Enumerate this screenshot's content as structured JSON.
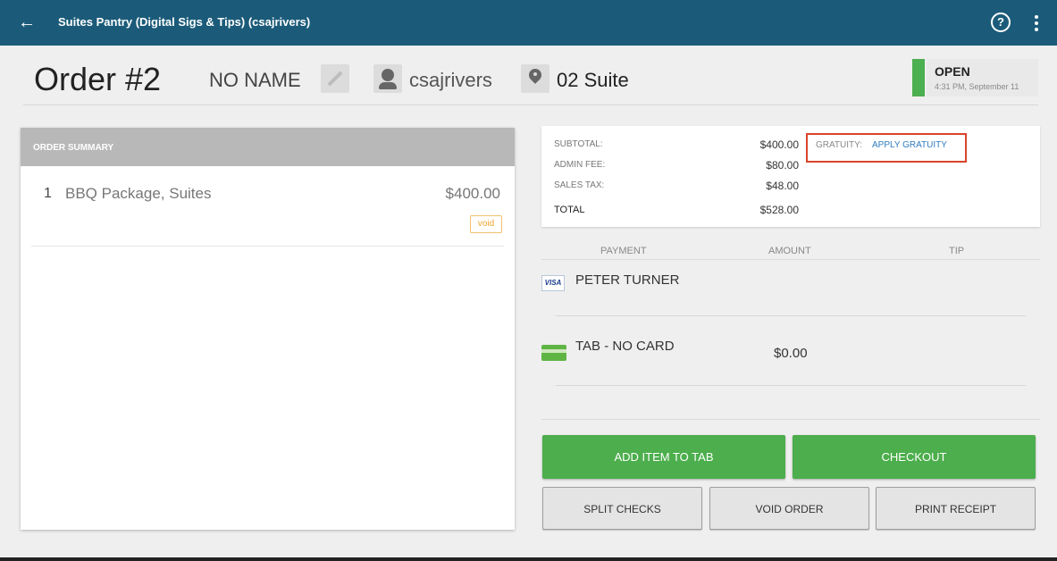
{
  "topbar": {
    "title": "Suites Pantry (Digital Sigs & Tips) (csajrivers)",
    "back_icon": "←",
    "help_icon": "?"
  },
  "header": {
    "order_title": "Order #2",
    "customer_name": "NO NAME",
    "user": "csajrivers",
    "location": "02 Suite",
    "status": "OPEN",
    "status_time": "4:31 PM, September 11"
  },
  "order_summary": {
    "heading": "ORDER SUMMARY",
    "items": [
      {
        "qty": "1",
        "name": "BBQ Package, Suites",
        "price": "$400.00",
        "void_label": "void"
      }
    ]
  },
  "totals": {
    "subtotal_label": "SUBTOTAL:",
    "subtotal": "$400.00",
    "admin_fee_label": "ADMIN FEE:",
    "admin_fee": "$80.00",
    "sales_tax_label": "SALES TAX:",
    "sales_tax": "$48.00",
    "total_label": "TOTAL",
    "total": "$528.00",
    "gratuity_label": "GRATUITY:",
    "apply_gratuity": "APPLY GRATUITY"
  },
  "payments": {
    "col_payment": "PAYMENT",
    "col_amount": "AMOUNT",
    "col_tip": "TIP",
    "rows": [
      {
        "name": "PETER TURNER",
        "amount": "",
        "card_label": "VISA"
      },
      {
        "name": "TAB - NO CARD",
        "amount": "$0.00"
      }
    ]
  },
  "actions": {
    "add_item": "ADD ITEM TO TAB",
    "checkout": "CHECKOUT",
    "split_checks": "SPLIT CHECKS",
    "void_order": "VOID ORDER",
    "print_receipt": "PRINT RECEIPT"
  },
  "colors": {
    "topbar": "#1b5b79",
    "primary_green": "#4cae4c",
    "status_green": "#4caf50",
    "void_orange": "#f0a52c",
    "highlight_red": "#d9442b",
    "link_blue": "#2f7bbf"
  }
}
